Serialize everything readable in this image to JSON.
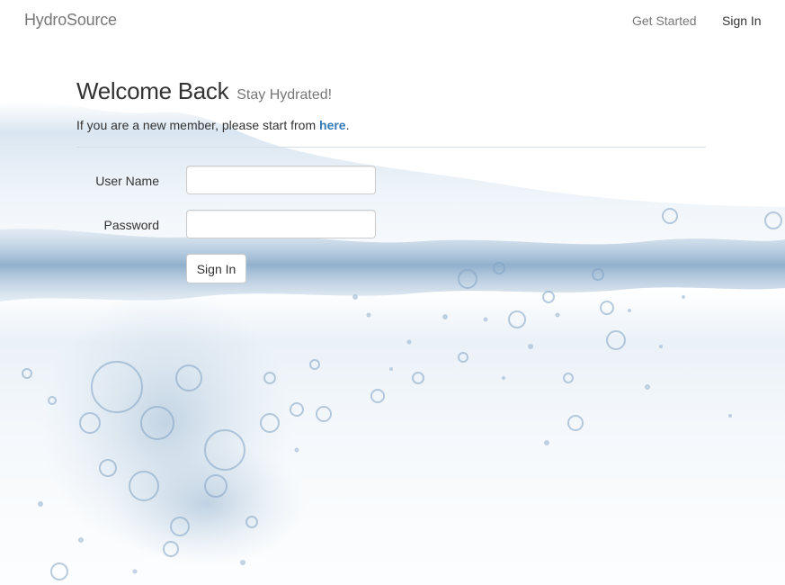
{
  "navbar": {
    "brand": "HydroSource",
    "links": [
      {
        "label": "Get Started"
      },
      {
        "label": "Sign In"
      }
    ]
  },
  "main": {
    "title": "Welcome Back",
    "subtitle": "Stay Hydrated!",
    "intro_text": "If you are a new member, please start from ",
    "intro_link": "here",
    "intro_end": "."
  },
  "form": {
    "username_label": "User Name",
    "username_value": "",
    "password_label": "Password",
    "password_value": "",
    "submit_label": "Sign In"
  },
  "colors": {
    "link": "#337ab7",
    "muted": "#777777",
    "water": "#7fa6c9"
  }
}
